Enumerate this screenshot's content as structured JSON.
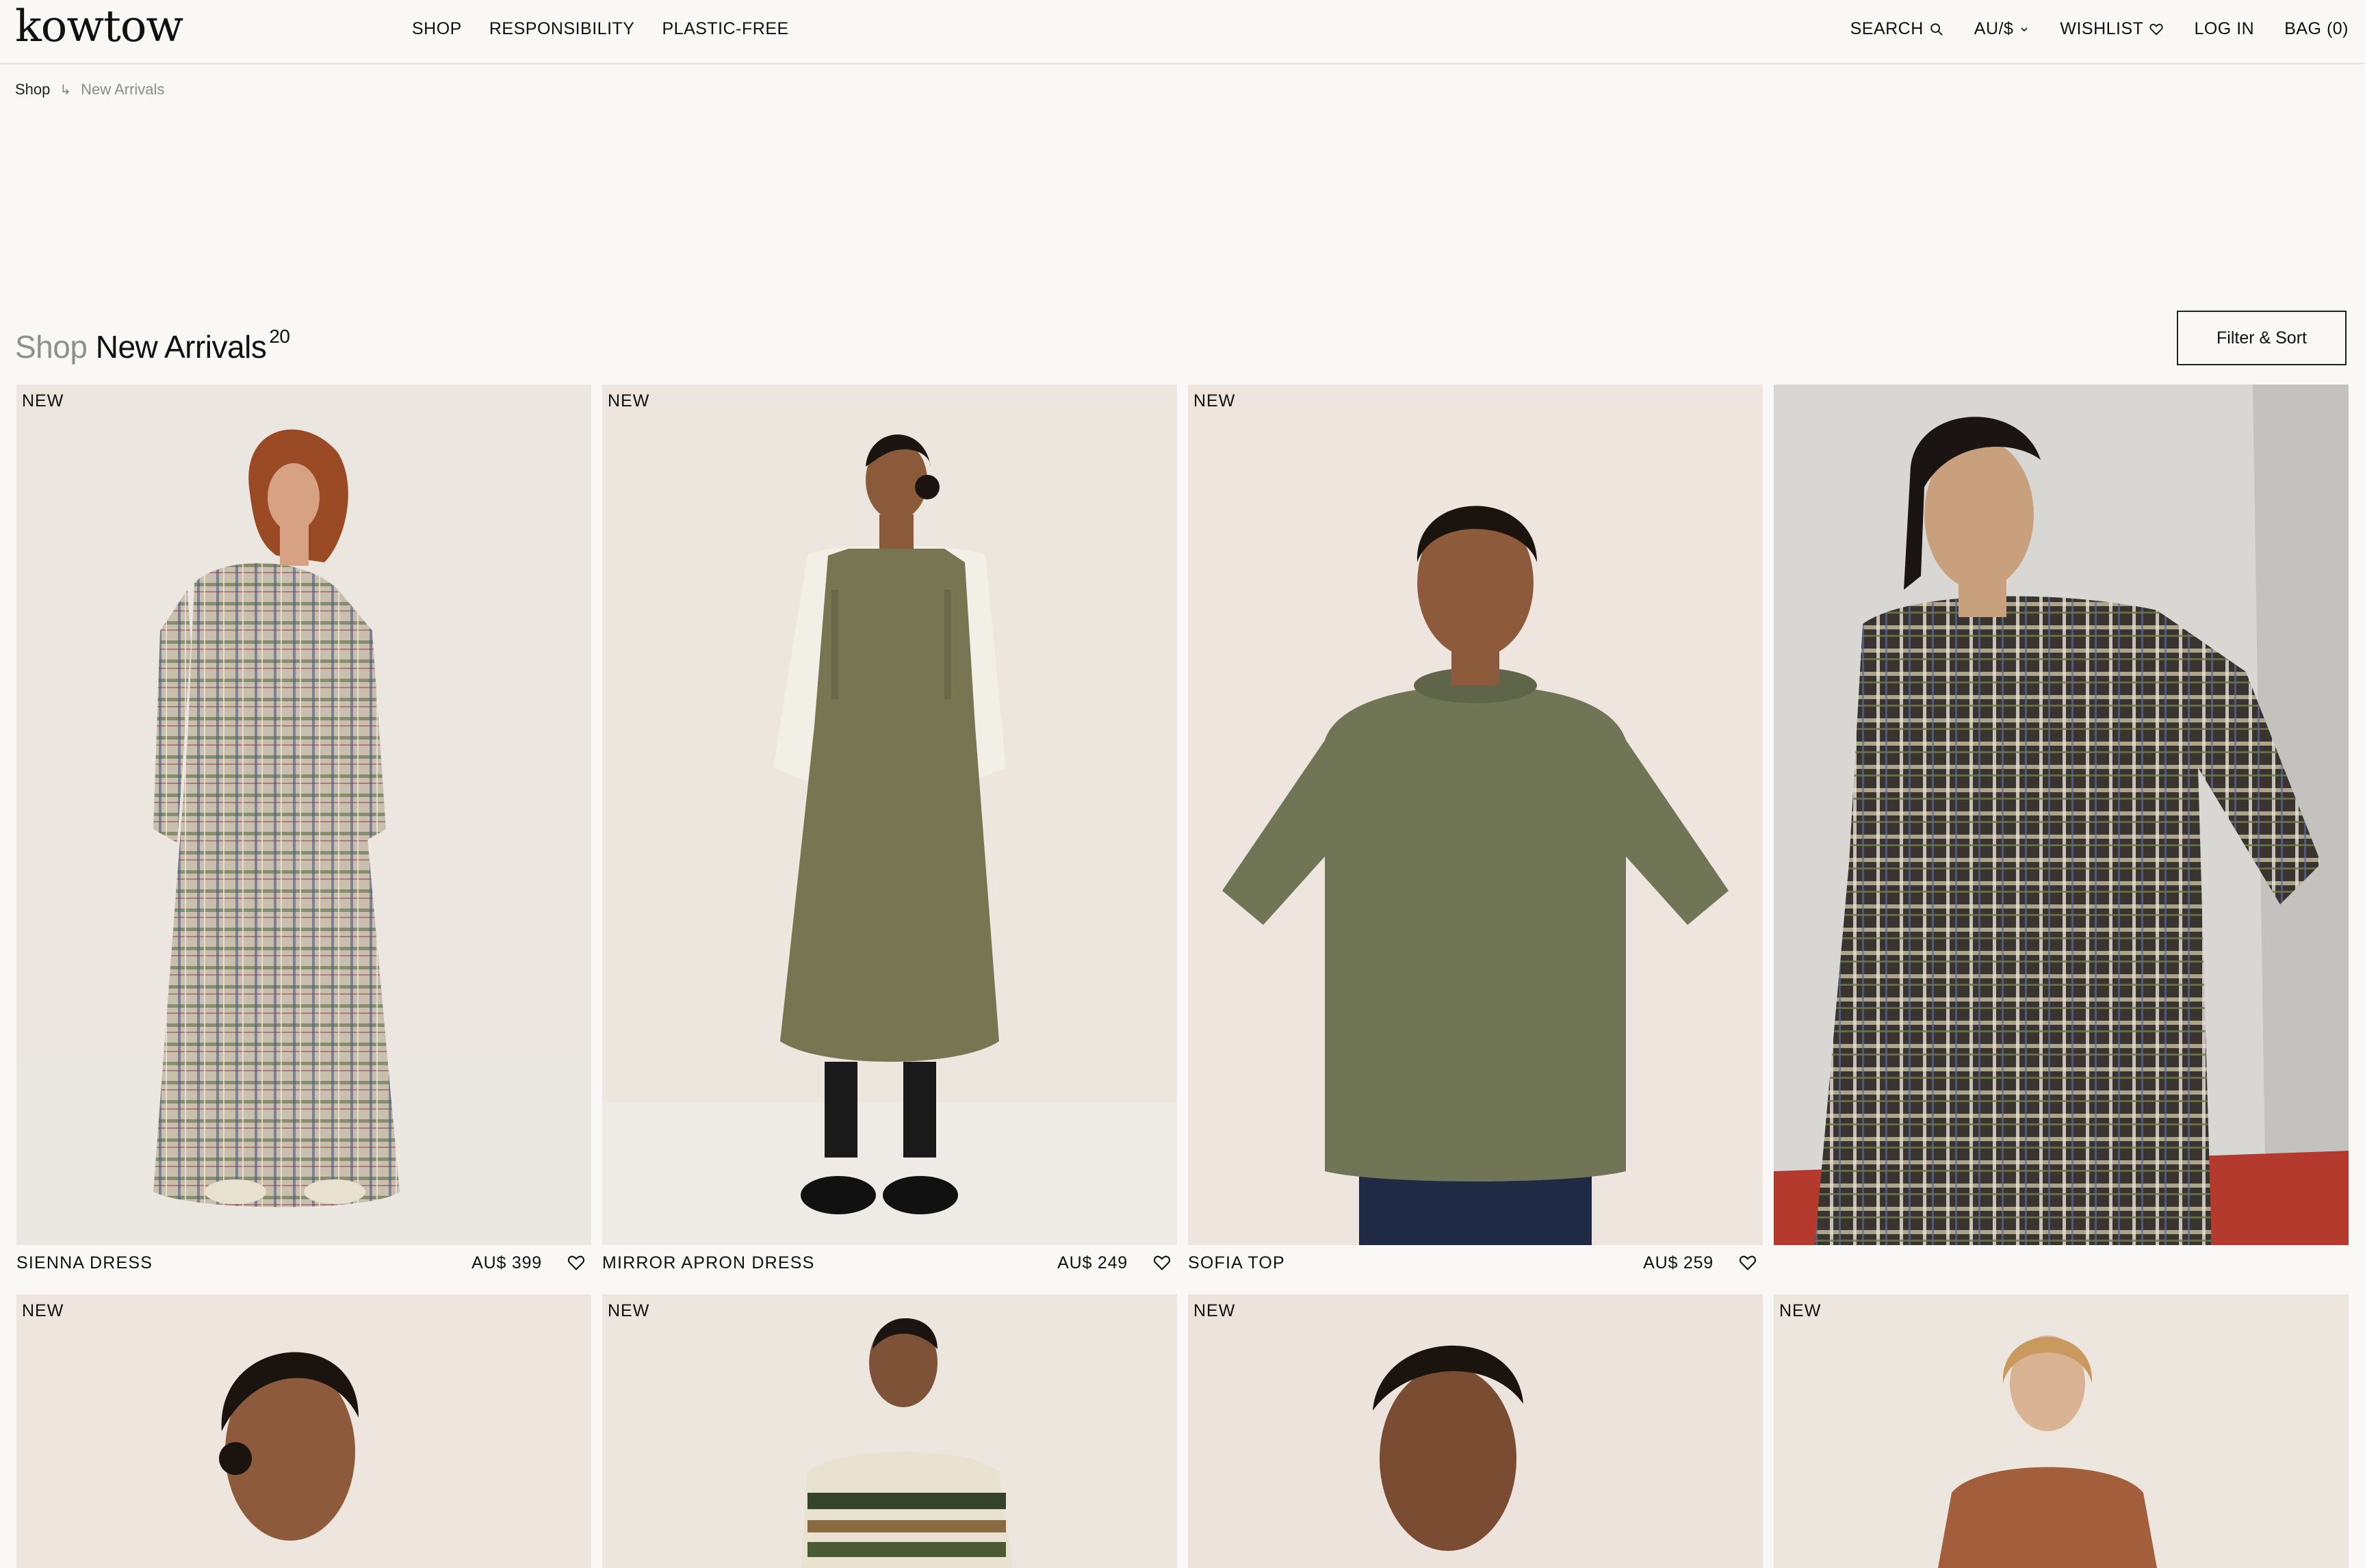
{
  "header": {
    "logo": "kowtow",
    "nav": [
      "SHOP",
      "RESPONSIBILITY",
      "PLASTIC-FREE"
    ],
    "search_label": "SEARCH",
    "currency_label": "AU/$",
    "wishlist_label": "WISHLIST",
    "login_label": "LOG IN",
    "bag_label": "BAG (0)"
  },
  "breadcrumb": {
    "home": "Shop",
    "separator": "↳",
    "current": "New Arrivals"
  },
  "heading": {
    "prefix": "Shop",
    "title": "New Arrivals",
    "count": "20"
  },
  "filter_label": "Filter & Sort",
  "products": [
    {
      "badge": "NEW",
      "name": "SIENNA DRESS",
      "price": "AU$ 399",
      "image": "model-plaid-dress"
    },
    {
      "badge": "NEW",
      "name": "MIRROR APRON DRESS",
      "price": "AU$ 249",
      "image": "model-olive-apron-dress"
    },
    {
      "badge": "NEW",
      "name": "SOFIA TOP",
      "price": "AU$ 259",
      "image": "model-olive-knit-top"
    },
    {
      "badge": "",
      "name": "",
      "price": "",
      "image": "campaign-plaid-dress"
    }
  ],
  "products_row2": [
    {
      "badge": "NEW",
      "image": "model-portrait"
    },
    {
      "badge": "NEW",
      "image": "model-striped-knit"
    },
    {
      "badge": "NEW",
      "image": "model-portrait-2"
    },
    {
      "badge": "NEW",
      "image": "model-rust-knit"
    }
  ],
  "colors": {
    "background": "#f9f8f6",
    "photo_backdrop": "#ece6e0",
    "text": "#111111",
    "muted": "#8f8f8f"
  }
}
